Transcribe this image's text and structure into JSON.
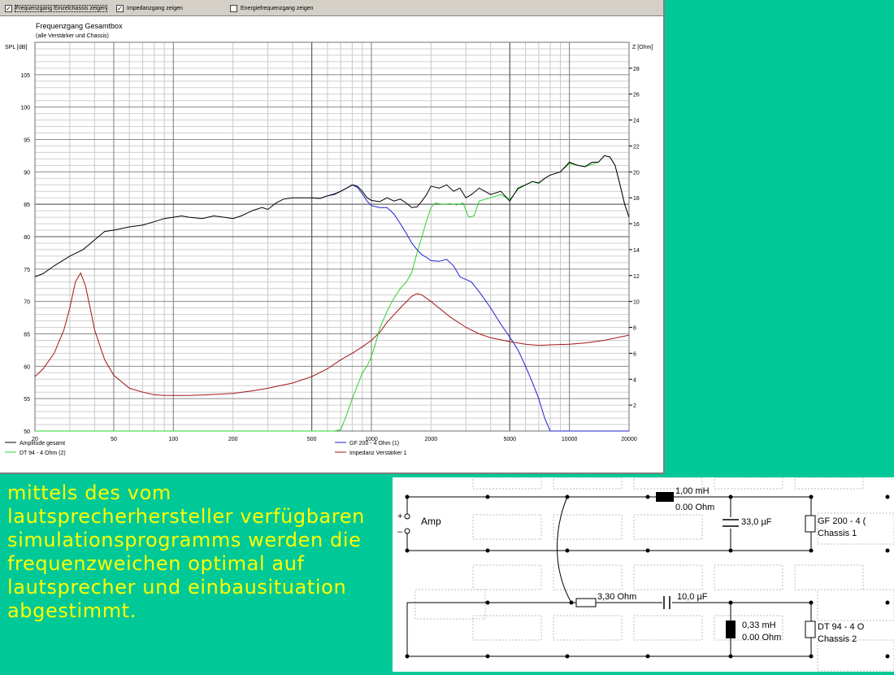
{
  "toolbar": {
    "checkboxes": [
      {
        "label": "Frequenzgang Einzelchassis zeigen",
        "checked": true,
        "mark": "✓"
      },
      {
        "label": "Impedanzgang zeigen",
        "checked": true,
        "mark": "✓"
      },
      {
        "label": "Energiefrequenzgang zeigen",
        "checked": false,
        "mark": ""
      }
    ]
  },
  "chart_data": {
    "type": "line",
    "title": "Frequenzgang Gesamtbox",
    "subtitle": "(alle Verstärker und Chassis)",
    "ylabel": "SPL [dB]",
    "y2label": "Z [Ohm]",
    "xscale": "log",
    "xlim": [
      20,
      20000
    ],
    "ylim": [
      50,
      110
    ],
    "y2lim": [
      0,
      30
    ],
    "x_ticks": [
      "20",
      "50",
      "100",
      "200",
      "500",
      "1000",
      "2000",
      "5000",
      "10000",
      "20000"
    ],
    "y_ticks": [
      "50",
      "55",
      "60",
      "65",
      "70",
      "75",
      "80",
      "85",
      "90",
      "95",
      "100",
      "105"
    ],
    "y2_ticks": [
      "2",
      "4",
      "6",
      "8",
      "10",
      "12",
      "14",
      "16",
      "18",
      "20",
      "22",
      "24",
      "26",
      "28"
    ],
    "grid": true,
    "legend_position": "bottom",
    "series": [
      {
        "name": "Amplitude gesamt",
        "axis": "left",
        "color": "#000000",
        "points": [
          [
            20,
            73.8
          ],
          [
            22,
            74.3
          ],
          [
            25,
            75.5
          ],
          [
            30,
            77
          ],
          [
            35,
            78
          ],
          [
            40,
            79.5
          ],
          [
            45,
            80.8
          ],
          [
            50,
            81.0
          ],
          [
            60,
            81.5
          ],
          [
            70,
            81.8
          ],
          [
            80,
            82.3
          ],
          [
            90,
            82.8
          ],
          [
            100,
            83.0
          ],
          [
            110,
            83.2
          ],
          [
            120,
            83.0
          ],
          [
            140,
            82.8
          ],
          [
            160,
            83.2
          ],
          [
            180,
            83.0
          ],
          [
            200,
            82.8
          ],
          [
            220,
            83.2
          ],
          [
            250,
            84.0
          ],
          [
            280,
            84.5
          ],
          [
            300,
            84.2
          ],
          [
            330,
            85.2
          ],
          [
            360,
            85.8
          ],
          [
            400,
            86.0
          ],
          [
            450,
            86.0
          ],
          [
            500,
            86.0
          ],
          [
            550,
            85.9
          ],
          [
            600,
            86.3
          ],
          [
            650,
            86.5
          ],
          [
            700,
            87.0
          ],
          [
            750,
            87.5
          ],
          [
            800,
            88.0
          ],
          [
            850,
            87.8
          ],
          [
            900,
            87.0
          ],
          [
            950,
            86.0
          ],
          [
            1000,
            85.6
          ],
          [
            1100,
            85.4
          ],
          [
            1200,
            86.0
          ],
          [
            1300,
            85.5
          ],
          [
            1400,
            85.8
          ],
          [
            1500,
            85.2
          ],
          [
            1600,
            84.5
          ],
          [
            1700,
            84.6
          ],
          [
            1800,
            85.5
          ],
          [
            1900,
            86.5
          ],
          [
            2000,
            87.8
          ],
          [
            2200,
            87.5
          ],
          [
            2400,
            88.0
          ],
          [
            2600,
            87.0
          ],
          [
            2800,
            87.5
          ],
          [
            3000,
            86.0
          ],
          [
            3200,
            86.5
          ],
          [
            3500,
            87.5
          ],
          [
            4000,
            86.5
          ],
          [
            4500,
            87.0
          ],
          [
            5000,
            85.5
          ],
          [
            5500,
            87.5
          ],
          [
            6000,
            88.0
          ],
          [
            6500,
            88.5
          ],
          [
            7000,
            88.3
          ],
          [
            7500,
            89.0
          ],
          [
            8000,
            89.5
          ],
          [
            9000,
            90.0
          ],
          [
            10000,
            91.5
          ],
          [
            11000,
            91.0
          ],
          [
            12000,
            90.8
          ],
          [
            13000,
            91.5
          ],
          [
            14000,
            91.5
          ],
          [
            15000,
            92.5
          ],
          [
            16000,
            92.3
          ],
          [
            17000,
            91.0
          ],
          [
            18000,
            88.0
          ],
          [
            19000,
            85.0
          ],
          [
            20000,
            83.0
          ]
        ]
      },
      {
        "name": "GF 200 - 4 Ohm  (1)",
        "axis": "left",
        "color": "#1f1fd6",
        "points": [
          [
            500,
            86.0
          ],
          [
            550,
            85.9
          ],
          [
            600,
            86.3
          ],
          [
            650,
            86.6
          ],
          [
            700,
            87.0
          ],
          [
            750,
            87.5
          ],
          [
            800,
            88.0
          ],
          [
            850,
            87.6
          ],
          [
            900,
            86.6
          ],
          [
            950,
            85.5
          ],
          [
            1000,
            84.8
          ],
          [
            1100,
            84.5
          ],
          [
            1200,
            84.5
          ],
          [
            1300,
            83.5
          ],
          [
            1400,
            82.0
          ],
          [
            1500,
            80.5
          ],
          [
            1600,
            79.0
          ],
          [
            1700,
            78.0
          ],
          [
            1800,
            77.2
          ],
          [
            1900,
            76.8
          ],
          [
            2000,
            76.3
          ],
          [
            2200,
            76.2
          ],
          [
            2400,
            76.5
          ],
          [
            2600,
            75.5
          ],
          [
            2800,
            73.8
          ],
          [
            3000,
            73.4
          ],
          [
            3200,
            73.0
          ],
          [
            3500,
            71.5
          ],
          [
            4000,
            69.0
          ],
          [
            4500,
            66.5
          ],
          [
            5000,
            64.5
          ],
          [
            5500,
            62.5
          ],
          [
            6000,
            60.0
          ],
          [
            6500,
            57.5
          ],
          [
            7000,
            55.0
          ],
          [
            7500,
            52.0
          ],
          [
            8000,
            50.0
          ],
          [
            20000,
            50.0
          ]
        ]
      },
      {
        "name": "DT 94 - 4 Ohm  (2)",
        "axis": "left",
        "color": "#2fd22f",
        "points": [
          [
            20,
            50
          ],
          [
            650,
            50
          ],
          [
            700,
            50.2
          ],
          [
            750,
            52.5
          ],
          [
            800,
            55.0
          ],
          [
            850,
            57.0
          ],
          [
            900,
            59.0
          ],
          [
            950,
            60.0
          ],
          [
            1000,
            61.5
          ],
          [
            1050,
            63.5
          ],
          [
            1100,
            65.8
          ],
          [
            1200,
            68.5
          ],
          [
            1300,
            70.5
          ],
          [
            1400,
            72.0
          ],
          [
            1500,
            73.0
          ],
          [
            1600,
            74.5
          ],
          [
            1700,
            77.5
          ],
          [
            1800,
            80.0
          ],
          [
            1900,
            82.5
          ],
          [
            2000,
            84.5
          ],
          [
            2100,
            85.2
          ],
          [
            2300,
            85.0
          ],
          [
            2500,
            85.1
          ],
          [
            2700,
            84.9
          ],
          [
            2900,
            85.2
          ],
          [
            3100,
            83.0
          ],
          [
            3300,
            83.2
          ],
          [
            3500,
            85.5
          ],
          [
            4000,
            86.0
          ],
          [
            4500,
            86.5
          ],
          [
            5000,
            85.7
          ],
          [
            5500,
            87.3
          ],
          [
            6000,
            88.0
          ],
          [
            6500,
            88.5
          ],
          [
            7000,
            88.2
          ],
          [
            7500,
            89.0
          ],
          [
            8000,
            89.5
          ],
          [
            9000,
            90.0
          ],
          [
            10000,
            91.3
          ],
          [
            12000,
            90.8
          ],
          [
            14000,
            91.5
          ],
          [
            15000,
            92.5
          ],
          [
            16000,
            92.3
          ],
          [
            17000,
            91.0
          ],
          [
            18000,
            88.0
          ],
          [
            19000,
            85.0
          ],
          [
            20000,
            83.0
          ]
        ]
      },
      {
        "name": "Impedanz Verstärker 1",
        "axis": "right",
        "color": "#a31515",
        "points": [
          [
            20,
            4.2
          ],
          [
            22,
            4.8
          ],
          [
            25,
            6.0
          ],
          [
            28,
            7.8
          ],
          [
            30,
            9.5
          ],
          [
            32,
            11.5
          ],
          [
            34,
            12.2
          ],
          [
            36,
            11.2
          ],
          [
            38,
            9.5
          ],
          [
            40,
            7.8
          ],
          [
            45,
            5.5
          ],
          [
            50,
            4.3
          ],
          [
            60,
            3.3
          ],
          [
            70,
            3.0
          ],
          [
            80,
            2.8
          ],
          [
            90,
            2.75
          ],
          [
            100,
            2.75
          ],
          [
            120,
            2.75
          ],
          [
            150,
            2.8
          ],
          [
            200,
            2.9
          ],
          [
            250,
            3.1
          ],
          [
            300,
            3.3
          ],
          [
            400,
            3.7
          ],
          [
            500,
            4.2
          ],
          [
            600,
            4.8
          ],
          [
            700,
            5.5
          ],
          [
            800,
            6.0
          ],
          [
            900,
            6.5
          ],
          [
            1000,
            7.0
          ],
          [
            1100,
            7.6
          ],
          [
            1200,
            8.4
          ],
          [
            1400,
            9.5
          ],
          [
            1600,
            10.4
          ],
          [
            1700,
            10.6
          ],
          [
            1800,
            10.5
          ],
          [
            2000,
            10.0
          ],
          [
            2500,
            8.8
          ],
          [
            3000,
            8.0
          ],
          [
            3500,
            7.5
          ],
          [
            4000,
            7.2
          ],
          [
            5000,
            6.9
          ],
          [
            6000,
            6.7
          ],
          [
            7000,
            6.6
          ],
          [
            8000,
            6.65
          ],
          [
            10000,
            6.7
          ],
          [
            12000,
            6.8
          ],
          [
            15000,
            7.0
          ],
          [
            20000,
            7.4
          ]
        ]
      }
    ]
  },
  "slide": {
    "text": "mittels des vom lautsprecherhersteller verfügbaren simulationsprogramms werden die frequenzweichen optimal auf lautsprecher und einbausituation abgestimmt."
  },
  "schematic": {
    "amp_label": "Amp",
    "plus": "+",
    "minus": "–",
    "chassis1_line1": "GF 200 - 4 (",
    "chassis1_line2": "Chassis 1",
    "chassis2_line1": "DT 94 - 4 O",
    "chassis2_line2": "Chassis 2",
    "inductor1_value": "1,00 mH",
    "inductor1_res": "0.00 Ohm",
    "cap1_value": "33,0 µF",
    "res1_value": "3,30 Ohm",
    "cap2_value": "10,0 µF",
    "inductor2_value": "0,33 mH",
    "inductor2_res": "0.00 Ohm"
  }
}
